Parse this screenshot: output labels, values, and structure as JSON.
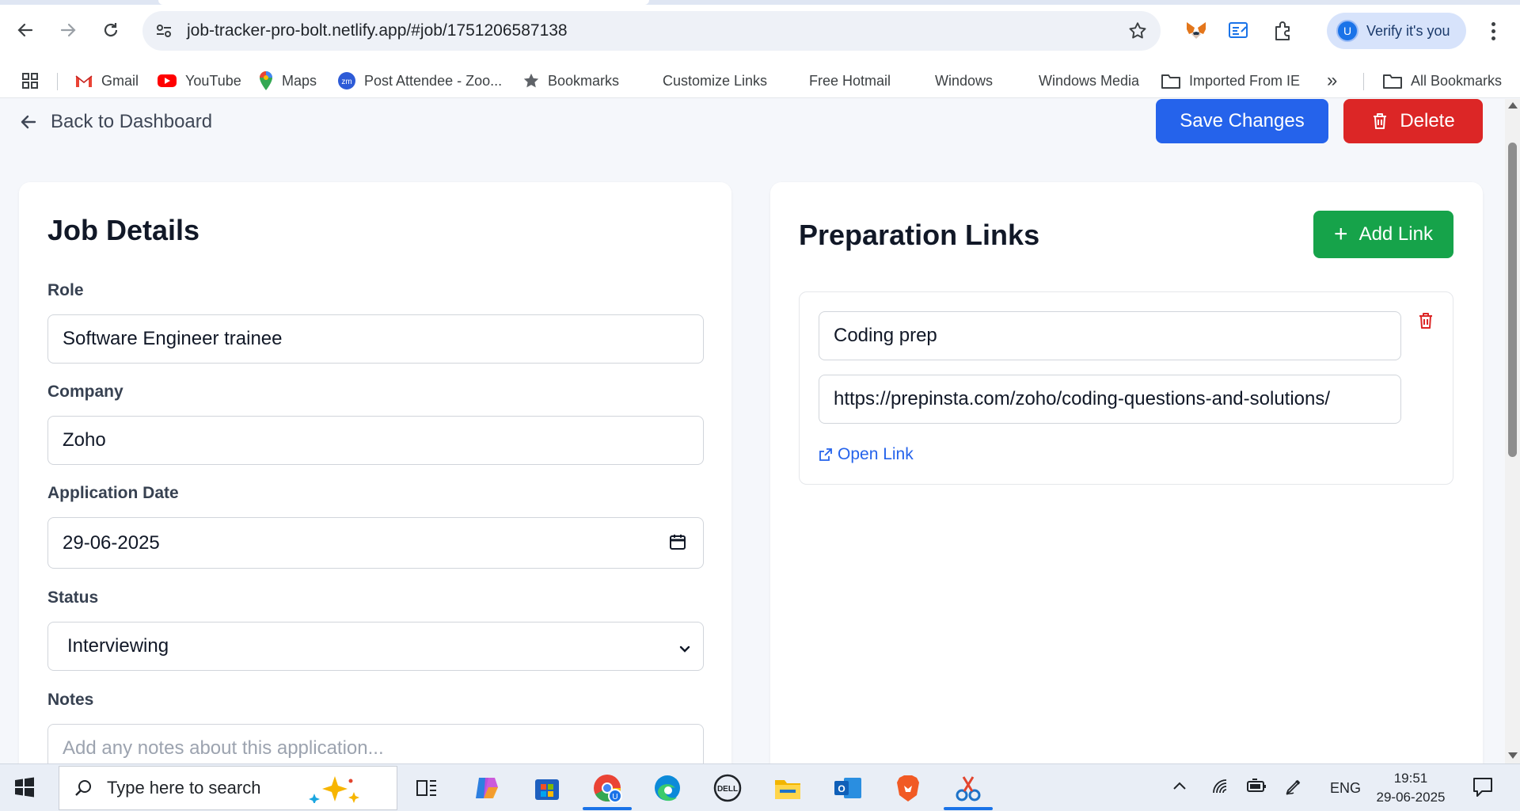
{
  "browser": {
    "url": "job-tracker-pro-bolt.netlify.app/#job/1751206587138",
    "profile_initial": "U",
    "profile_label": "Verify it's you",
    "bookmarks": [
      {
        "label": "Gmail",
        "icon": "gmail-icon"
      },
      {
        "label": "YouTube",
        "icon": "youtube-icon"
      },
      {
        "label": "Maps",
        "icon": "maps-icon"
      },
      {
        "label": "Post Attendee - Zoo...",
        "icon": "zoom-icon"
      },
      {
        "label": "Bookmarks",
        "icon": "star-icon"
      },
      {
        "label": "Customize Links",
        "icon": "microsoft-icon"
      },
      {
        "label": "Free Hotmail",
        "icon": "microsoft-icon"
      },
      {
        "label": "Windows",
        "icon": "microsoft-icon"
      },
      {
        "label": "Windows Media",
        "icon": "microsoft-icon"
      },
      {
        "label": "Imported From IE",
        "icon": "folder-icon"
      }
    ],
    "overflow_label": "»",
    "all_bookmarks_label": "All Bookmarks"
  },
  "header": {
    "back_label": "Back to Dashboard",
    "save_label": "Save Changes",
    "delete_label": "Delete"
  },
  "job_details": {
    "title": "Job Details",
    "role_label": "Role",
    "role_value": "Software Engineer trainee",
    "company_label": "Company",
    "company_value": "Zoho",
    "date_label": "Application Date",
    "date_value": "29-06-2025",
    "status_label": "Status",
    "status_value": "Interviewing",
    "notes_label": "Notes",
    "notes_placeholder": "Add any notes about this application..."
  },
  "prep_links": {
    "title": "Preparation Links",
    "add_label": "Add Link",
    "items": [
      {
        "name": "Coding prep",
        "url": "https://prepinsta.com/zoho/coding-questions-and-solutions/",
        "open_label": "Open Link"
      }
    ]
  },
  "taskbar": {
    "search_placeholder": "Type here to search",
    "language": "ENG",
    "time": "19:51",
    "date": "29-06-2025"
  },
  "colors": {
    "primary": "#2563eb",
    "danger": "#dc2626",
    "success": "#16a34a"
  }
}
